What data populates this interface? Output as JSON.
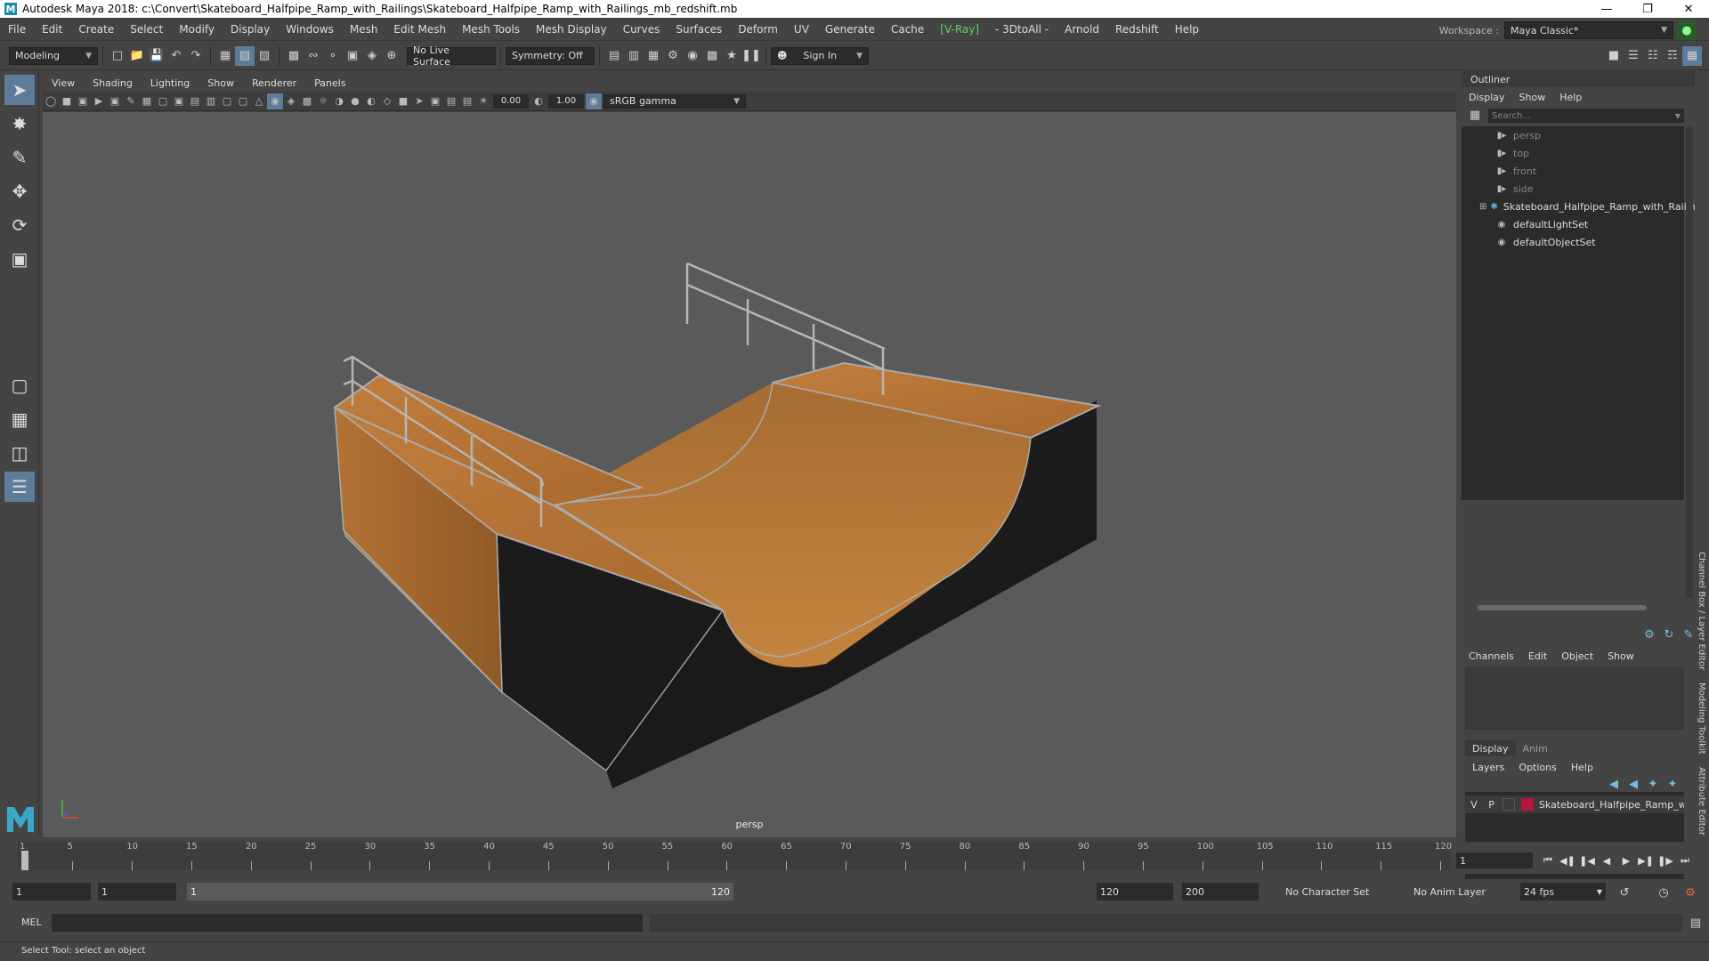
{
  "window": {
    "title": "Autodesk Maya 2018: c:\\Convert\\Skateboard_Halfpipe_Ramp_with_Railings\\Skateboard_Halfpipe_Ramp_with_Railings_mb_redshift.mb",
    "icon": "maya-icon"
  },
  "menubar": {
    "items": [
      "File",
      "Edit",
      "Create",
      "Select",
      "Modify",
      "Display",
      "Windows",
      "Mesh",
      "Edit Mesh",
      "Mesh Tools",
      "Mesh Display",
      "Curves",
      "Surfaces",
      "Deform",
      "UV",
      "Generate",
      "Cache",
      "[V-Ray]",
      "- 3DtoAll -",
      "Arnold",
      "Redshift",
      "Help"
    ],
    "workspace_label": "Workspace :",
    "workspace_value": "Maya Classic*"
  },
  "shelf": {
    "mode": "Modeling",
    "live_surface": "No Live Surface",
    "symmetry": "Symmetry: Off",
    "sign_in": "Sign In"
  },
  "viewport": {
    "menu": [
      "View",
      "Shading",
      "Lighting",
      "Show",
      "Renderer",
      "Panels"
    ],
    "exposure": "0.00",
    "gamma": "1.00",
    "color_space": "sRGB gamma",
    "camera": "persp"
  },
  "outliner": {
    "title": "Outliner",
    "menu": [
      "Display",
      "Show",
      "Help"
    ],
    "search_placeholder": "Search...",
    "items": [
      {
        "label": "persp",
        "icon": "camera-icon",
        "dim": true
      },
      {
        "label": "top",
        "icon": "camera-icon",
        "dim": true
      },
      {
        "label": "front",
        "icon": "camera-icon",
        "dim": true
      },
      {
        "label": "side",
        "icon": "camera-icon",
        "dim": true
      },
      {
        "label": "Skateboard_Halfpipe_Ramp_with_Railin",
        "icon": "group-icon",
        "dim": false
      },
      {
        "label": "defaultLightSet",
        "icon": "set-icon",
        "dim": false
      },
      {
        "label": "defaultObjectSet",
        "icon": "set-icon",
        "dim": false
      }
    ]
  },
  "channels": {
    "menu": [
      "Channels",
      "Edit",
      "Object",
      "Show"
    ]
  },
  "layers": {
    "tabs": [
      "Display",
      "Anim"
    ],
    "menu": [
      "Layers",
      "Options",
      "Help"
    ],
    "row": {
      "v": "V",
      "p": "P",
      "name": "Skateboard_Halfpipe_Ramp_w",
      "color": "#b5163d"
    }
  },
  "side_tabs": [
    "Channel Box / Layer Editor",
    "Modeling Toolkit",
    "Attribute Editor"
  ],
  "timeslider": {
    "ticks": [
      1,
      5,
      10,
      15,
      20,
      25,
      30,
      35,
      40,
      45,
      50,
      55,
      60,
      65,
      70,
      75,
      80,
      85,
      90,
      95,
      100,
      105,
      110,
      115,
      120
    ],
    "min": 1,
    "max": 120,
    "current_frame": "1"
  },
  "range": {
    "start": "1",
    "playback_start": "1",
    "slider_start": "1",
    "slider_end": "120",
    "playback_end": "120",
    "end": "200",
    "character_set": "No Character Set",
    "anim_layer": "No Anim Layer",
    "fps": "24 fps"
  },
  "command": {
    "label": "MEL"
  },
  "status": {
    "text": "Select Tool: select an object"
  }
}
